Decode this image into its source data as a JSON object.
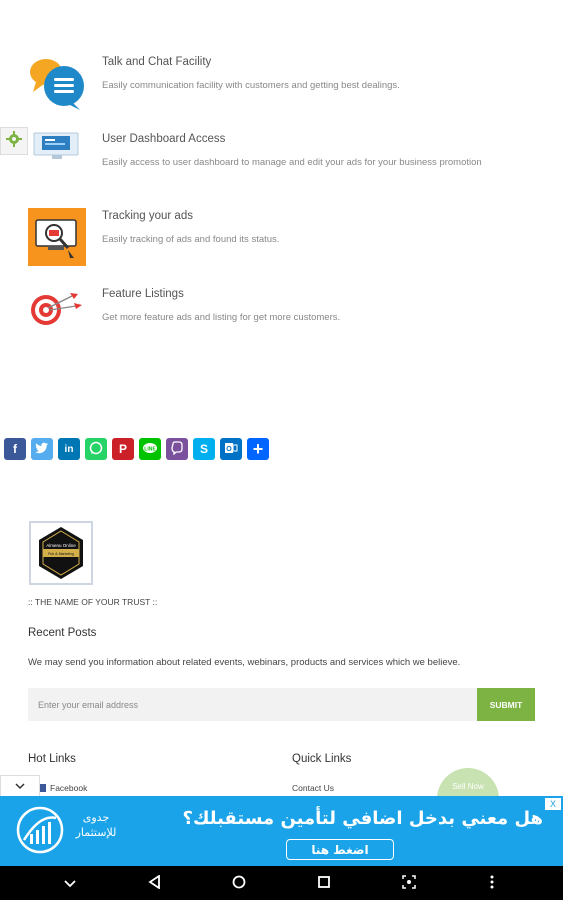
{
  "features": [
    {
      "title": "Talk and Chat Facility",
      "desc": "Easily communication facility with customers and getting best dealings.",
      "icon": "chat-bubbles-icon"
    },
    {
      "title": "User Dashboard Access",
      "desc": "Easily access to user dashboard to manage and edit your ads for your business promotion",
      "icon": "monitor-dashboard-icon"
    },
    {
      "title": "Tracking your ads",
      "desc": "Easily tracking of ads and found its status.",
      "icon": "tracking-screen-icon"
    },
    {
      "title": "Feature Listings",
      "desc": "Get more feature ads and listing for get more customers.",
      "icon": "target-icon"
    }
  ],
  "share_icons": [
    "facebook",
    "twitter",
    "linkedin",
    "whatsapp",
    "pinterest",
    "line",
    "viber",
    "skype",
    "outlook",
    "share"
  ],
  "footer": {
    "logo_text_1": "Almenu Online",
    "logo_text_2": "Pub & Marketing",
    "tagline": ":: THE NAME OF YOUR TRUST ::",
    "recent_posts": "Recent Posts",
    "newsletter_text": "We may send you information about related events, webinars, products and services which we believe.",
    "email_placeholder": "Enter your email address",
    "submit_label": "SUBMIT",
    "hot_links_title": "Hot Links",
    "hot_links": [
      "Facebook"
    ],
    "quick_links_title": "Quick Links",
    "quick_links": [
      "Contact Us"
    ],
    "chat_bubble_text": "Sell Now"
  },
  "ad": {
    "headline": "هل معني بدخل اضافي لتأمين مستقبلك؟",
    "cta": "اضغط هنا",
    "brand": "جدوى للإستثمار",
    "close": "X"
  },
  "colors": {
    "accent_green": "#7cb342",
    "ad_blue": "#1aa3e8",
    "facebook": "#3b5998",
    "twitter": "#55acee",
    "linkedin": "#0077b5",
    "whatsapp": "#25d366",
    "pinterest": "#cb2027",
    "line": "#00c300",
    "viber": "#7b519d",
    "skype": "#00aff0",
    "outlook": "#0072c6",
    "share": "#0166ff"
  }
}
